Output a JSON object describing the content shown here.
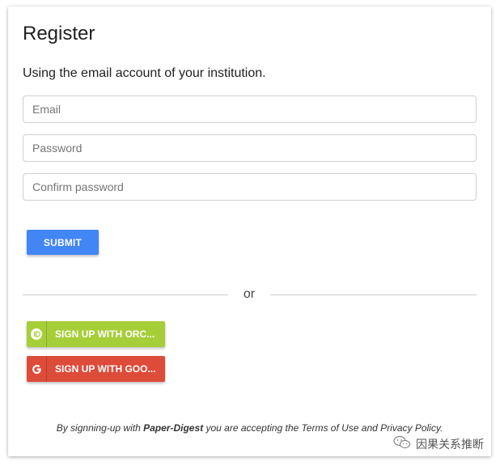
{
  "form": {
    "title": "Register",
    "subtitle": "Using the email account of your institution.",
    "email_placeholder": "Email",
    "password_placeholder": "Password",
    "confirm_placeholder": "Confirm password",
    "submit_label": "SUBMIT"
  },
  "divider": {
    "text": "or"
  },
  "social": {
    "orcid": {
      "label": "SIGN UP WITH ORC...",
      "icon": "orcid-icon",
      "color": "#a6ce39"
    },
    "google": {
      "label": "SIGN UP WITH GOO...",
      "icon": "google-g-icon",
      "color": "#dd4b39"
    }
  },
  "footer": {
    "prefix": "By signning-up with ",
    "brand": "Paper-Digest",
    "suffix": " you are accepting the Terms of Use and Privacy Policy."
  },
  "watermark": {
    "text": "因果关系推断",
    "icon": "wechat-icon"
  },
  "colors": {
    "primary": "#4285f4",
    "orcid": "#a6ce39",
    "google": "#dd4b39"
  }
}
